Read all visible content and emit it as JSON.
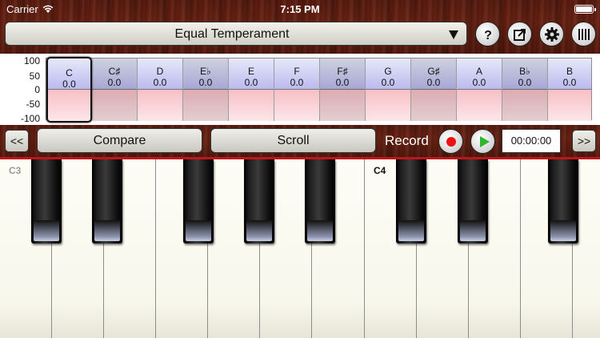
{
  "status": {
    "carrier": "Carrier",
    "time": "7:15 PM"
  },
  "header": {
    "temperament": "Equal Temperament",
    "icons": [
      "help-icon",
      "export-icon",
      "gear-icon",
      "tuning-fork-icon"
    ]
  },
  "cents": {
    "axis": [
      "100",
      "50",
      "0",
      "-50",
      "-100"
    ],
    "notes": [
      {
        "name": "C",
        "value": "0.0"
      },
      {
        "name": "C♯",
        "value": "0.0"
      },
      {
        "name": "D",
        "value": "0.0"
      },
      {
        "name": "E♭",
        "value": "0.0"
      },
      {
        "name": "E",
        "value": "0.0"
      },
      {
        "name": "F",
        "value": "0.0"
      },
      {
        "name": "F♯",
        "value": "0.0"
      },
      {
        "name": "G",
        "value": "0.0"
      },
      {
        "name": "G♯",
        "value": "0.0"
      },
      {
        "name": "A",
        "value": "0.0"
      },
      {
        "name": "B♭",
        "value": "0.0"
      },
      {
        "name": "B",
        "value": "0.0"
      }
    ]
  },
  "controls": {
    "prev": "<<",
    "compare": "Compare",
    "scroll": "Scroll",
    "record": "Record",
    "timer": "00:00:00",
    "next": ">>"
  },
  "keyboard": {
    "labels": [
      "C3",
      "C4"
    ]
  },
  "colors": {
    "record": "#e11111",
    "play": "#2db52d",
    "keyboard_line": "#c0141a"
  }
}
